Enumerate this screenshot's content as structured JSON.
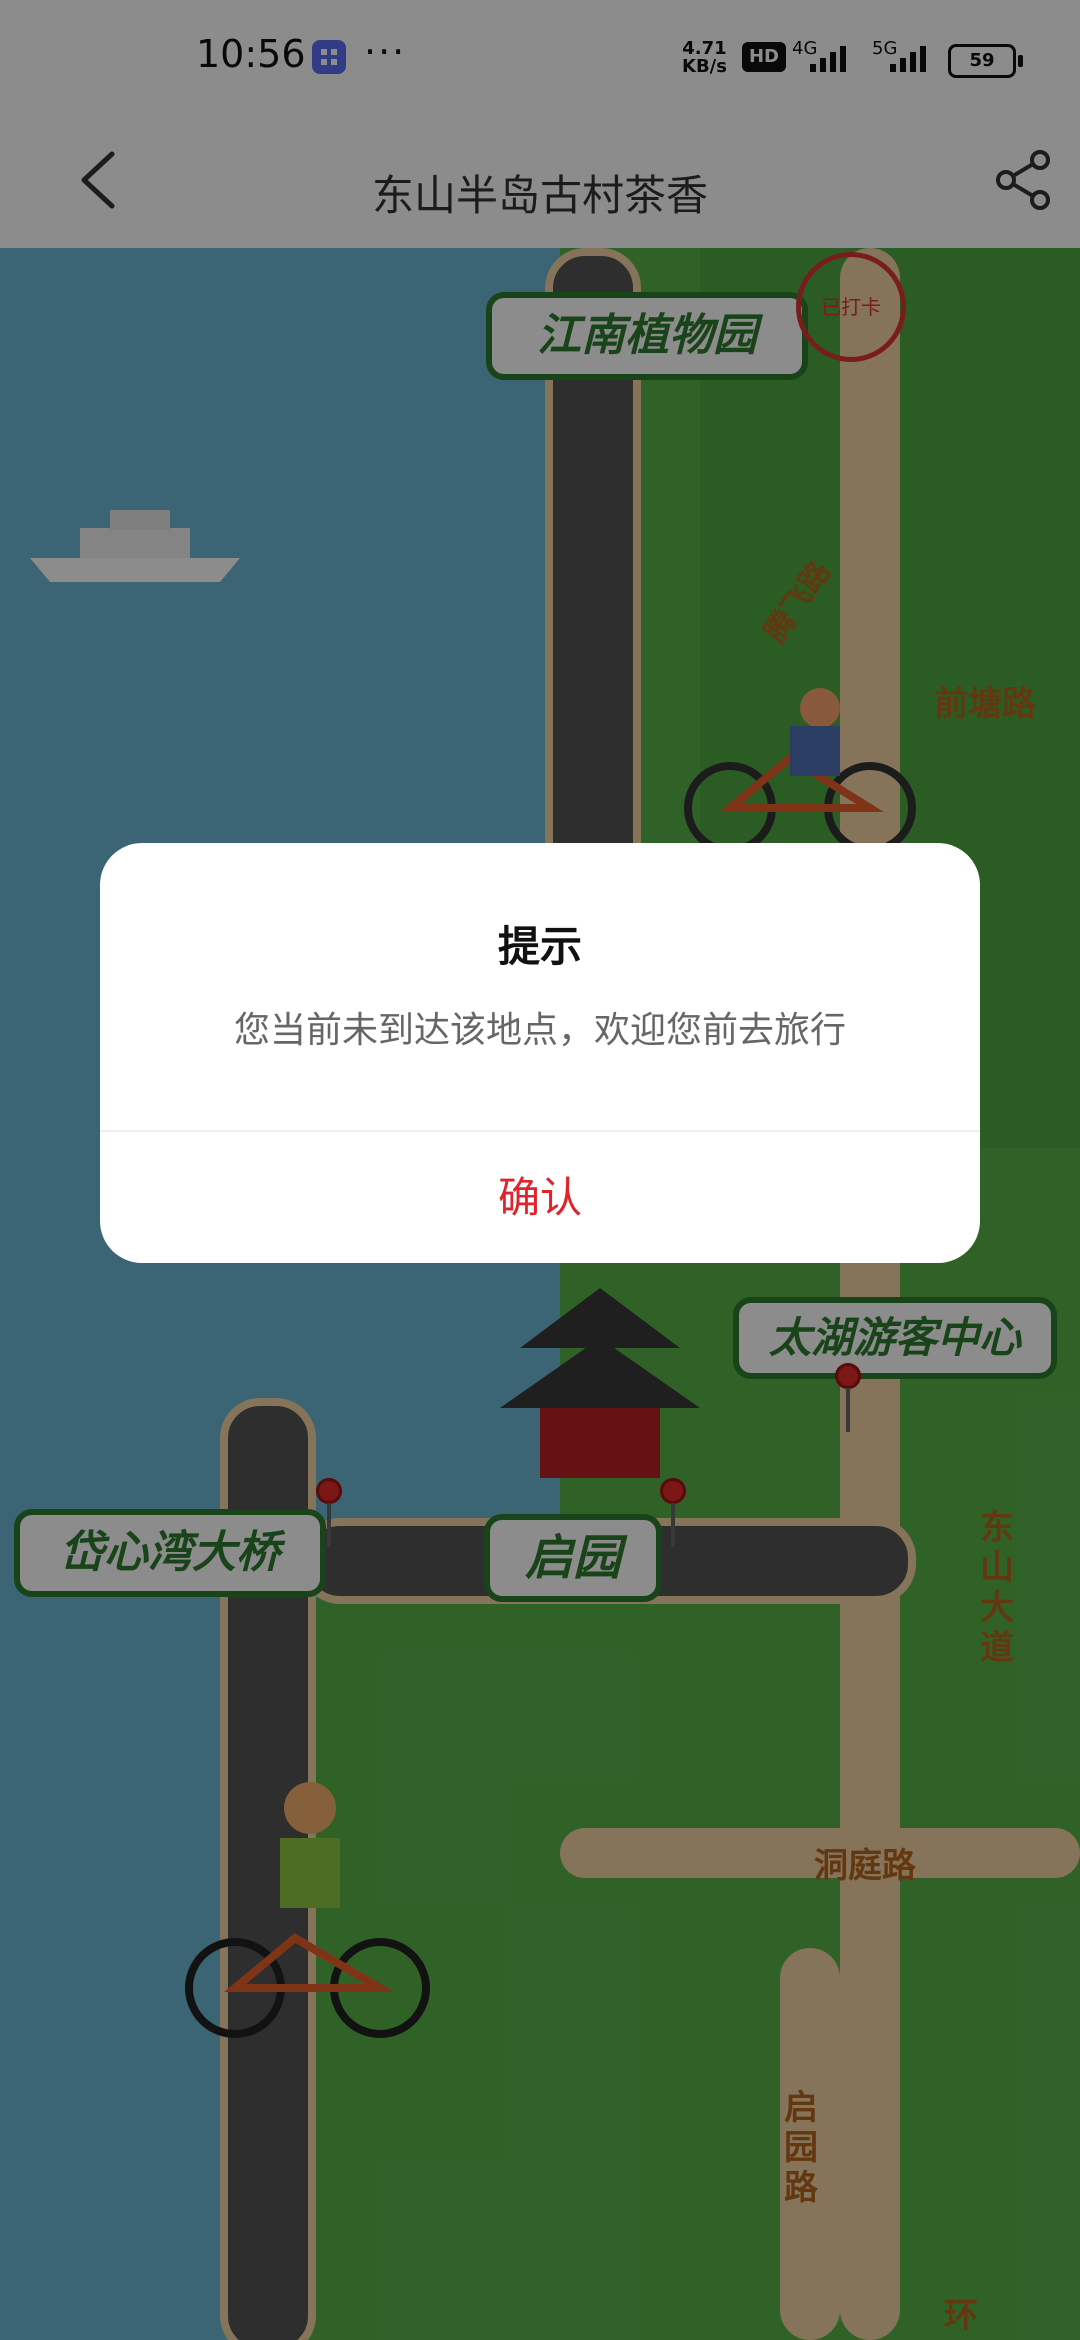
{
  "status_bar": {
    "time": "10:56",
    "more_dots": "···",
    "net_speed_value": "4.71",
    "net_speed_unit": "KB/s",
    "hd_label": "HD",
    "network_4g": "4G",
    "network_5g": "5G",
    "battery": "59"
  },
  "header": {
    "title": "东山半岛古村茶香"
  },
  "map": {
    "labels": {
      "jiangnan": "江南植物园",
      "stamp": "已打卡",
      "tengfei_road": "腾飞路",
      "qiantang_road": "前塘路",
      "taihu_center": "太湖游客中心",
      "daixinwan_bridge": "岱心湾大桥",
      "qiyuan": "启园",
      "dongshan_avenue": "东山大道",
      "dongting_road": "洞庭路",
      "qiyuan_road": "启园路",
      "huan": "环"
    }
  },
  "dialog": {
    "title": "提示",
    "message": "您当前未到达该地点，欢迎您前去旅行",
    "confirm_label": "确认"
  }
}
